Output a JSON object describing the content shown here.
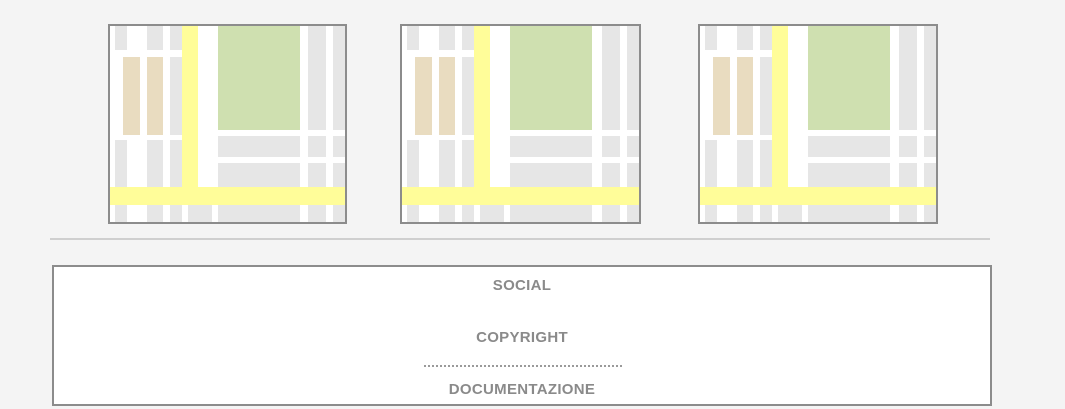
{
  "colors": {
    "page_background": "#f4f4f4",
    "block_gray": "#e6e6e6",
    "block_tan": "#e9dcc0",
    "park_green": "#cfe0b0",
    "road_yellow": "#fffd99",
    "border_gray": "#8c8c8c"
  },
  "map_thumbnails": [
    {
      "icon": "map-thumbnail-icon"
    },
    {
      "icon": "map-thumbnail-icon"
    },
    {
      "icon": "map-thumbnail-icon"
    }
  ],
  "footer": {
    "social_label": "SOCIAL",
    "copyright_label": "COPYRIGHT",
    "documentation_label": "DOCUMENTAZIONE"
  }
}
